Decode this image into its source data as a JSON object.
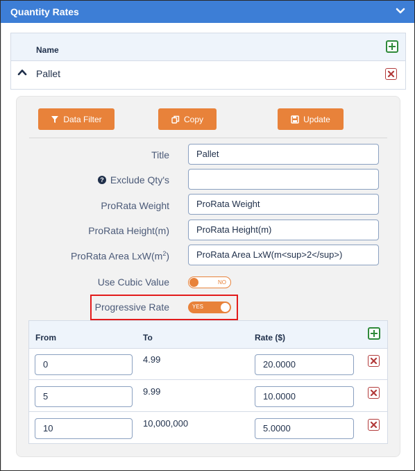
{
  "panel": {
    "title": "Quantity Rates"
  },
  "name_grid": {
    "column_name": "Name",
    "rows": [
      {
        "name": "Pallet"
      }
    ]
  },
  "toolbar": {
    "data_filter_label": "Data Filter",
    "copy_label": "Copy",
    "update_label": "Update"
  },
  "form": {
    "title_label": "Title",
    "title_value": "Pallet",
    "exclude_label": "Exclude Qty's",
    "exclude_value": "",
    "prorata_weight_label": "ProRata Weight",
    "prorata_weight_value": "ProRata Weight",
    "prorata_height_label": "ProRata Height(m)",
    "prorata_height_value": "ProRata Height(m)",
    "prorata_area_label": "ProRata Area LxW(m",
    "prorata_area_sup": "2",
    "prorata_area_close": ")",
    "prorata_area_value": "ProRata Area LxW(m<sup>2</sup>)",
    "use_cubic_label": "Use Cubic Value",
    "use_cubic_state": "NO",
    "progressive_label": "Progressive Rate",
    "progressive_state": "YES"
  },
  "rates": {
    "col_from": "From",
    "col_to": "To",
    "col_rate": "Rate ($)",
    "rows": [
      {
        "from": "0",
        "to": "4.99",
        "rate": "20.0000"
      },
      {
        "from": "5",
        "to": "9.99",
        "rate": "10.0000"
      },
      {
        "from": "10",
        "to": "10,000,000",
        "rate": "5.0000"
      }
    ]
  },
  "colors": {
    "header_blue": "#3d7ed6",
    "button_orange": "#e8823a",
    "add_green": "#2f8a3a",
    "delete_red": "#b23a3a",
    "highlight_red": "#e21b1b"
  }
}
